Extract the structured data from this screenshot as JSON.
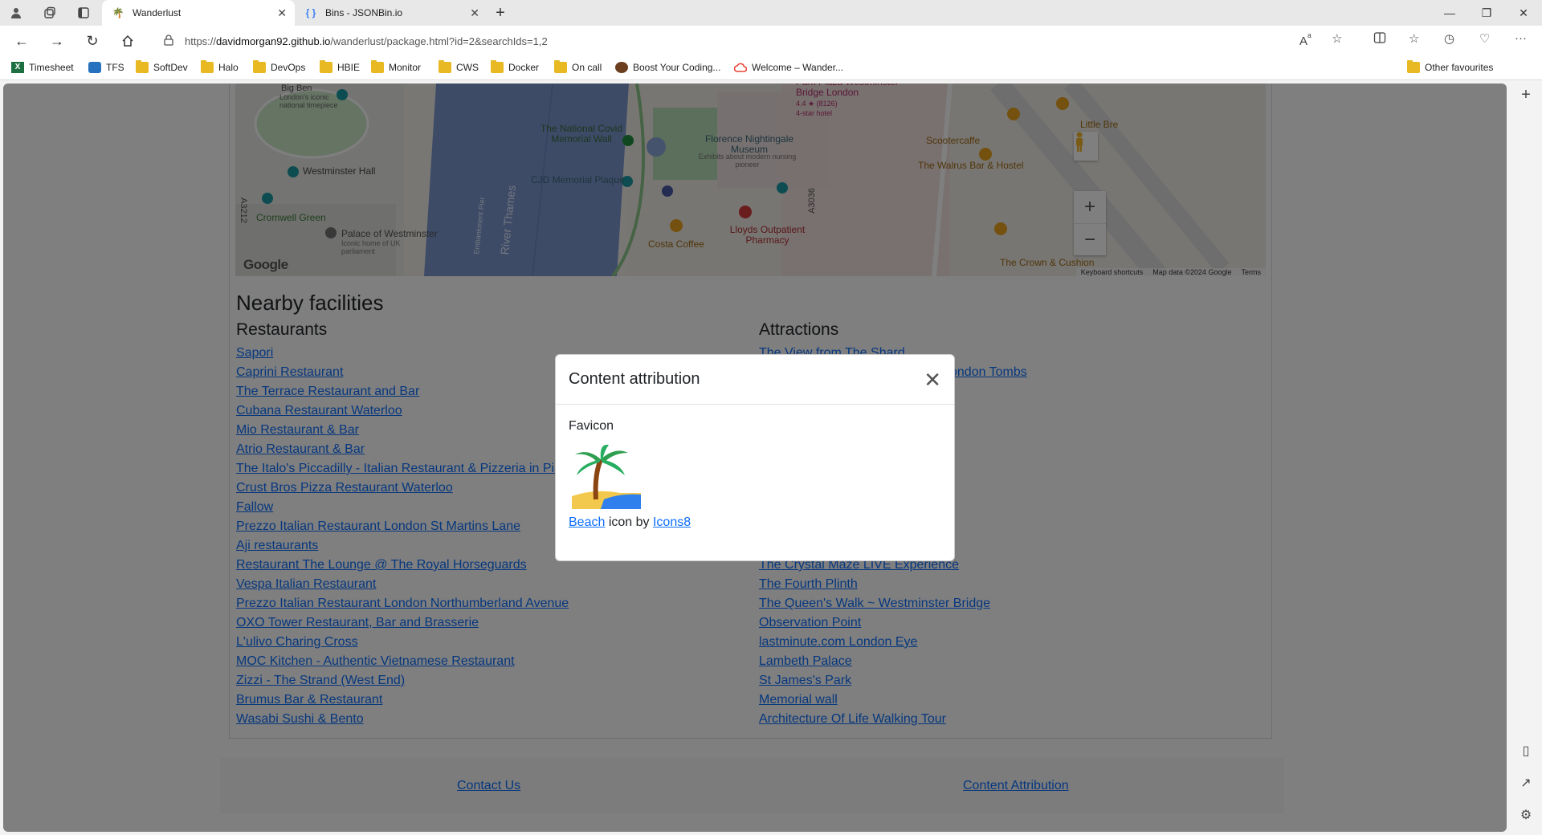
{
  "browser": {
    "tabs": [
      {
        "title": "Wanderlust",
        "active": true
      },
      {
        "title": "Bins - JSONBin.io",
        "active": false
      }
    ],
    "url_prefix": "https://",
    "url_host": "davidmorgan92.github.io",
    "url_path": "/wanderlust/package.html?id=2&searchIds=1,2",
    "bookmarks": [
      "Timesheet",
      "TFS",
      "SoftDev",
      "Halo",
      "DevOps",
      "HBIE",
      "Monitor",
      "CWS",
      "Docker",
      "On call",
      "Boost Your Coding...",
      "Welcome – Wander..."
    ],
    "other_favourites": "Other favourites"
  },
  "map": {
    "labels": {
      "big_ben": "Big Ben",
      "big_ben_sub": "London's iconic national timepiece",
      "westminster_hall": "Westminster Hall",
      "cromwell_green": "Cromwell Green",
      "palace": "Palace of Westminster",
      "palace_sub": "Iconic home of UK parliament",
      "a3212": "A3212",
      "covid_wall": "The National Covid Memorial Wall",
      "cjd_plaque": "CJD Memorial Plaque",
      "embankment_pier": "Embankment Pier",
      "river": "River Thames",
      "nightingale": "Florence Nightingale Museum",
      "nightingale_sub": "Exhibits about modern nursing pioneer",
      "park_plaza": "Park Plaza Westminster Bridge London",
      "park_plaza_rating": "4.4 ★ (8126)",
      "park_plaza_class": "4-star hotel",
      "a3036": "A3036",
      "costa": "Costa Coffee",
      "lloyds": "Lloyds Outpatient Pharmacy",
      "scootercaffe": "Scootercaffe",
      "walrus": "The Walrus Bar & Hostel",
      "little_bre": "Little Bre",
      "crown": "The Crown & Cushion",
      "google": "Google",
      "shortcuts": "Keyboard shortcuts",
      "map_data": "Map data ©2024 Google",
      "terms": "Terms"
    }
  },
  "facilities": {
    "heading": "Nearby facilities",
    "restaurants_heading": "Restaurants",
    "attractions_heading": "Attractions",
    "restaurants": [
      "Sapori",
      "Caprini Restaurant",
      "The Terrace Restaurant and Bar",
      "Cubana Restaurant Waterloo",
      "Mio Restaurant & Bar",
      "Atrio Restaurant & Bar",
      "The Italo's Piccadilly - Italian Restaurant & Pizzeria in Pic",
      "Crust Bros Pizza Restaurant Waterloo",
      "Fallow",
      "Prezzo Italian Restaurant London St Martins Lane",
      "Aji restaurants",
      "Restaurant The Lounge @ The Royal Horseguards",
      "Vespa Italian Restaurant",
      "Prezzo Italian Restaurant London Northumberland Avenue",
      "OXO Tower Restaurant, Bar and Brasserie",
      "L'ulivo Charing Cross",
      "MOC Kitchen - Authentic Vietnamese Restaurant",
      "Zizzi - The Strand (West End)",
      "Brumus Bar & Restaurant",
      "Wasabi Sushi & Bento"
    ],
    "attractions": [
      "The View from The Shard",
      "ondon Tombs",
      "",
      "",
      "",
      "",
      "",
      "",
      "",
      "",
      "",
      "The Crystal Maze LIVE Experience",
      "The Fourth Plinth",
      "The Queen's Walk ~ Westminster Bridge",
      "Observation Point",
      "lastminute.com London Eye",
      "Lambeth Palace",
      "St James's Park",
      "Memorial wall",
      "Architecture Of Life Walking Tour"
    ]
  },
  "footer": {
    "contact": "Contact Us",
    "attribution": "Content Attribution"
  },
  "modal": {
    "title": "Content attribution",
    "section": "Favicon",
    "link1": "Beach",
    "middle": " icon by ",
    "link2": "Icons8"
  }
}
